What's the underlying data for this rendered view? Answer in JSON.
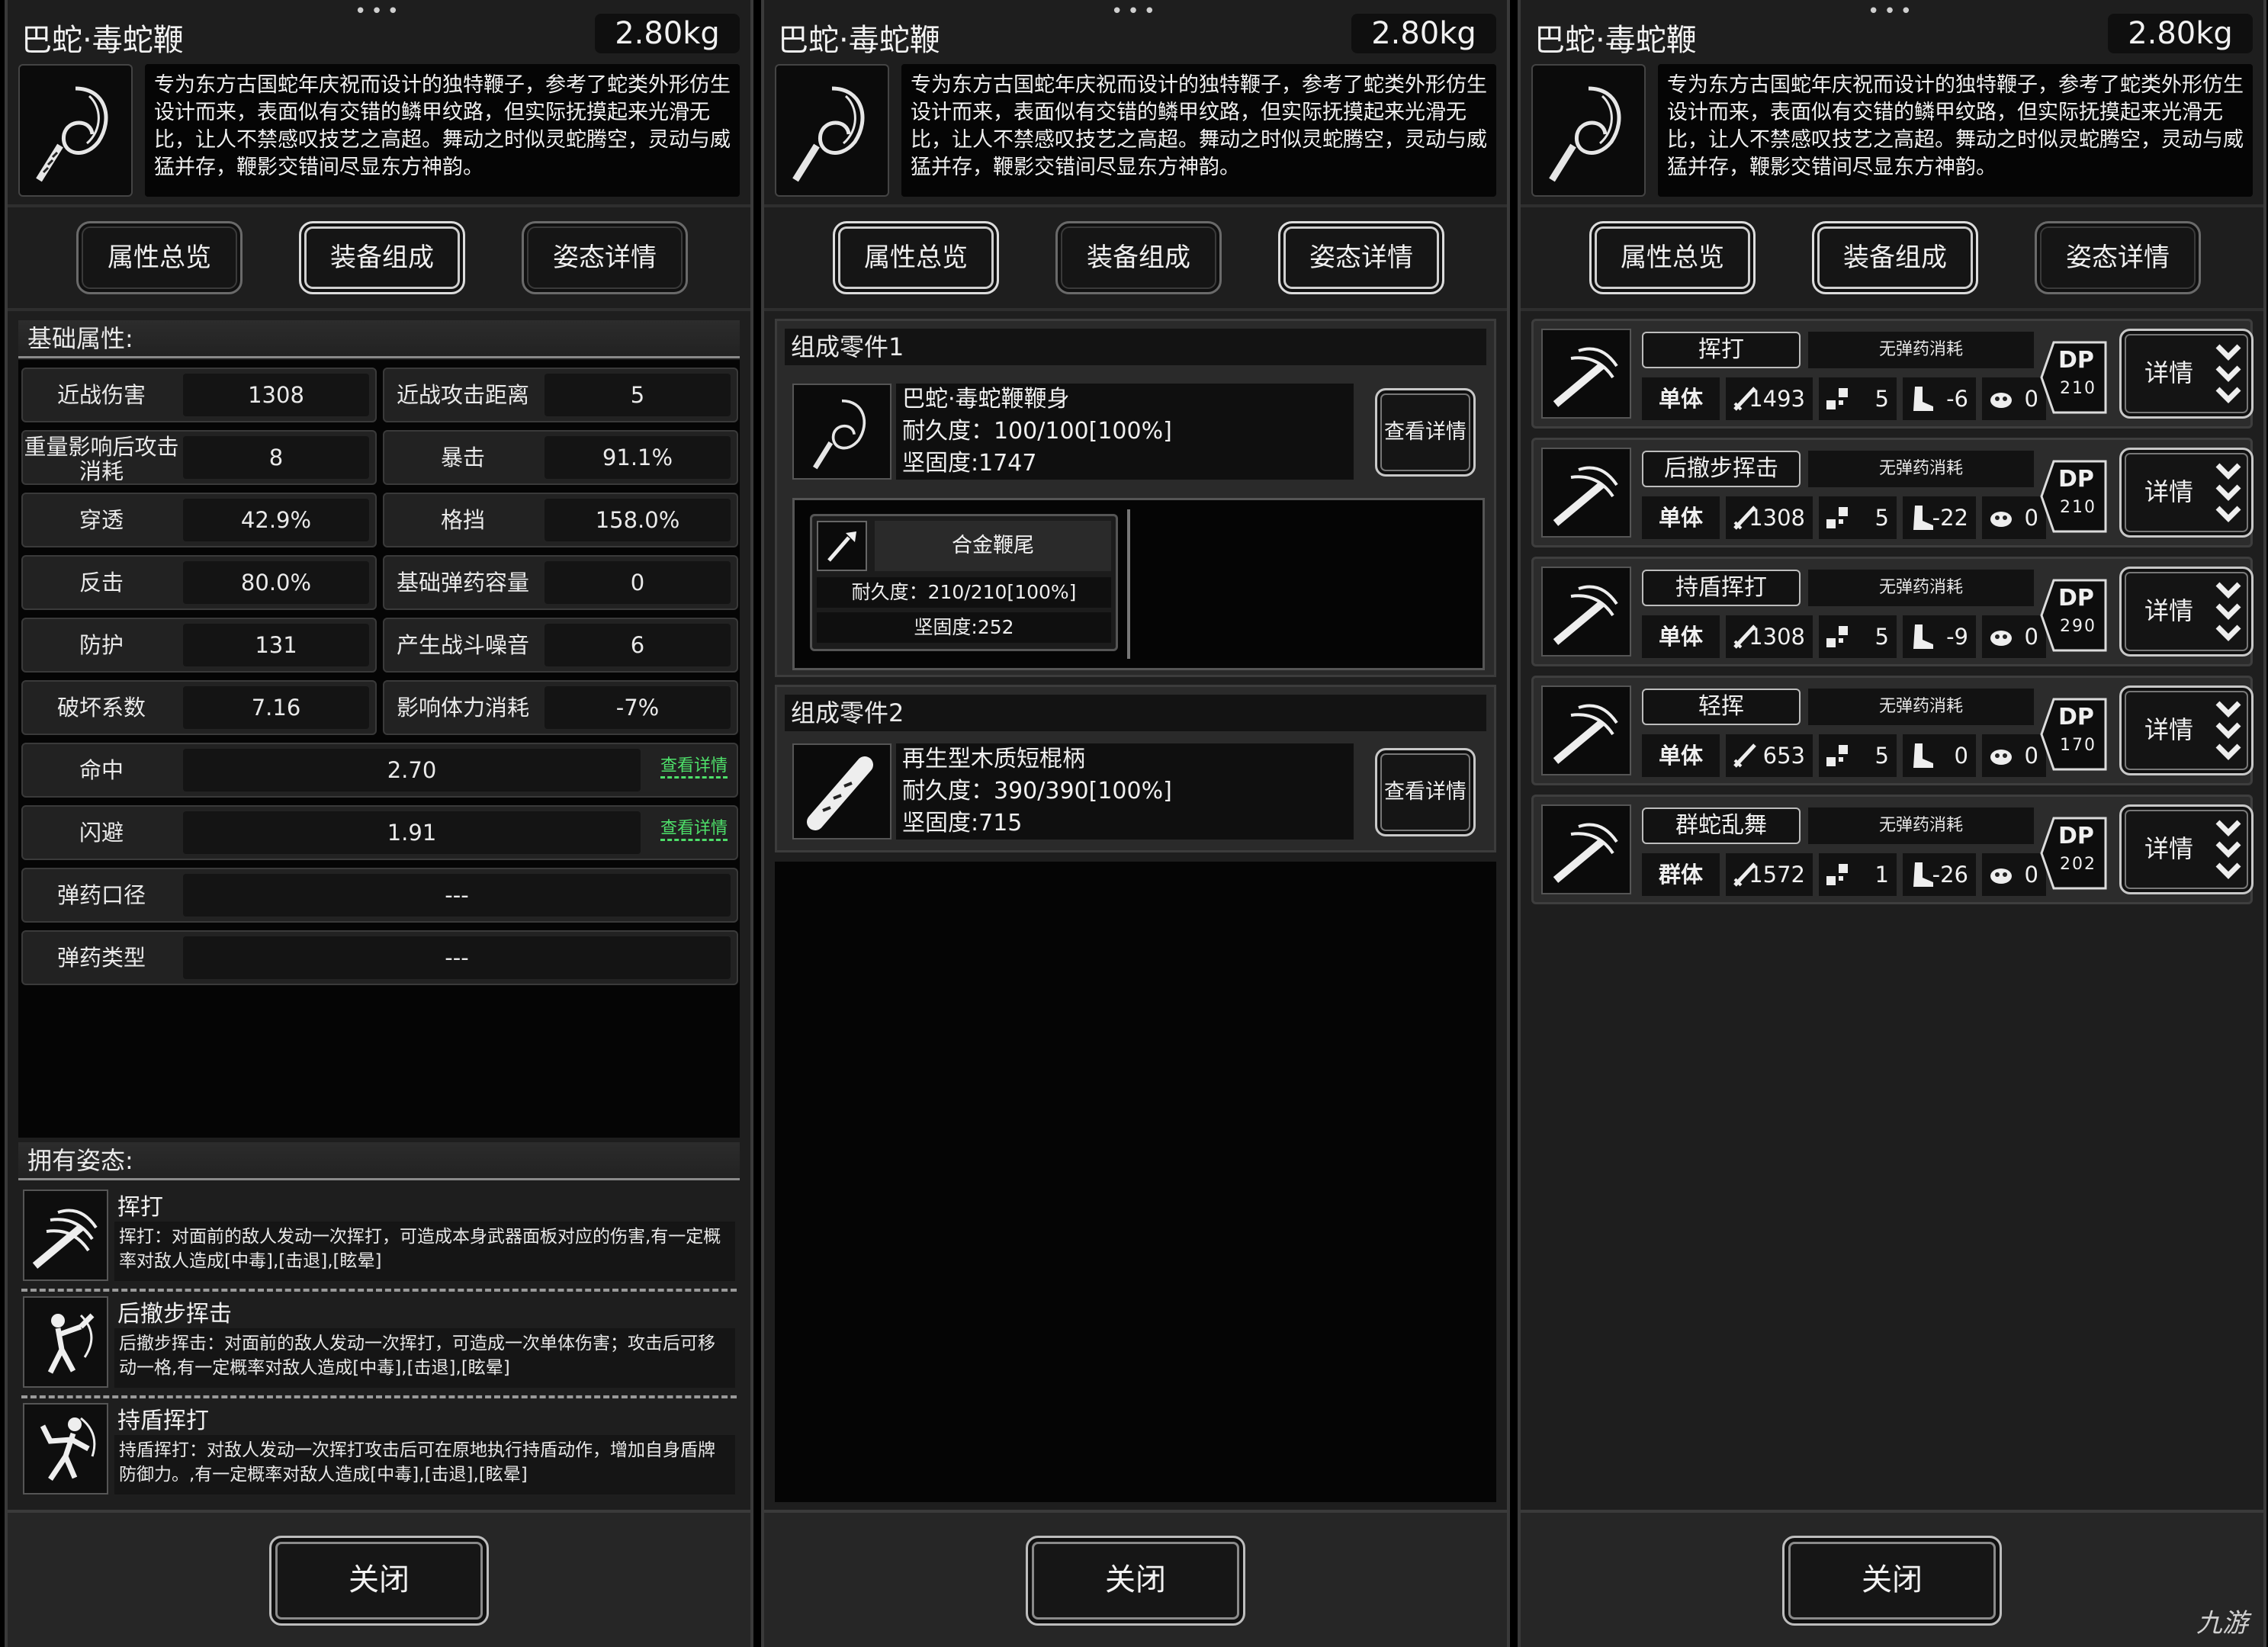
{
  "weapon": {
    "name": "巴蛇·毒蛇鞭",
    "weight": "2.80kg",
    "description": "专为东方古国蛇年庆祝而设计的独特鞭子，参考了蛇类外形仿生设计而来，表面似有交错的鳞甲纹路，但实际抚摸起来光滑无比，让人不禁感叹技艺之高超。舞动之时似灵蛇腾空，灵动与威猛并存，鞭影交错间尽显东方神韵。"
  },
  "tabs": [
    "属性总览",
    "装备组成",
    "姿态详情"
  ],
  "close_label": "关闭",
  "overview": {
    "base_header": "基础属性:",
    "stats": [
      {
        "label": "近战伤害",
        "value": "1308"
      },
      {
        "label": "近战攻击距离",
        "value": "5"
      },
      {
        "label": "重量影响后攻击消耗",
        "value": "8"
      },
      {
        "label": "暴击",
        "value": "91.1%"
      },
      {
        "label": "穿透",
        "value": "42.9%"
      },
      {
        "label": "格挡",
        "value": "158.0%"
      },
      {
        "label": "反击",
        "value": "80.0%"
      },
      {
        "label": "基础弹药容量",
        "value": "0"
      },
      {
        "label": "防护",
        "value": "131"
      },
      {
        "label": "产生战斗噪音",
        "value": "6"
      },
      {
        "label": "破坏系数",
        "value": "7.16"
      },
      {
        "label": "影响体力消耗",
        "value": "-7%"
      }
    ],
    "wide_stats": [
      {
        "label": "命中",
        "value": "2.70",
        "more": "查看详情"
      },
      {
        "label": "闪避",
        "value": "1.91",
        "more": "查看详情"
      },
      {
        "label": "弹药口径",
        "value": "---"
      },
      {
        "label": "弹药类型",
        "value": "---"
      }
    ],
    "postures_header": "拥有姿态:",
    "postures": [
      {
        "name": "挥打",
        "desc": "挥打：对面前的敌人发动一次挥打，可造成本身武器面板对应的伤害,有一定概率对敌人造成[中毒],[击退],[眩晕]"
      },
      {
        "name": "后撤步挥击",
        "desc": "后撤步挥击：对面前的敌人发动一次挥打，可造成一次单体伤害；攻击后可移动一格,有一定概率对敌人造成[中毒],[击退],[眩晕]"
      },
      {
        "name": "持盾挥打",
        "desc": "持盾挥打：对敌人发动一次挥打攻击后可在原地执行持盾动作，增加自身盾牌防御力。,有一定概率对敌人造成[中毒],[击退],[眩晕]"
      }
    ]
  },
  "composition": {
    "part1_header": "组成零件1",
    "part1": {
      "name": "巴蛇·毒蛇鞭鞭身",
      "durability": "耐久度：100/100[100%]",
      "hardness": "坚固度:1747",
      "button": "查看详情"
    },
    "subpart": {
      "name": "合金鞭尾",
      "durability": "耐久度：210/210[100%]",
      "hardness": "坚固度:252"
    },
    "part2_header": "组成零件2",
    "part2": {
      "name": "再生型木质短棍柄",
      "durability": "耐久度：390/390[100%]",
      "hardness": "坚固度:715",
      "button": "查看详情"
    }
  },
  "skills": {
    "ammo_text": "无弹药消耗",
    "dp_label": "DP",
    "detail_label": "详情",
    "list": [
      {
        "name": "挥打",
        "target": "单体",
        "atk": "1493",
        "hit": "5",
        "move": "-6",
        "noise": "0",
        "dp": "210"
      },
      {
        "name": "后撤步挥击",
        "target": "单体",
        "atk": "1308",
        "hit": "5",
        "move": "-22",
        "noise": "0",
        "dp": "210"
      },
      {
        "name": "持盾挥打",
        "target": "单体",
        "atk": "1308",
        "hit": "5",
        "move": "-9",
        "noise": "0",
        "dp": "290"
      },
      {
        "name": "轻挥",
        "target": "单体",
        "atk": "653",
        "hit": "5",
        "move": "0",
        "noise": "0",
        "dp": "170"
      },
      {
        "name": "群蛇乱舞",
        "target": "群体",
        "atk": "1572",
        "hit": "1",
        "move": "-26",
        "noise": "0",
        "dp": "202"
      }
    ]
  },
  "watermark": "九游",
  "colors": {
    "background": "#1e1e1e",
    "accent_green": "#4ee06a",
    "border": "#3a3a3a"
  }
}
